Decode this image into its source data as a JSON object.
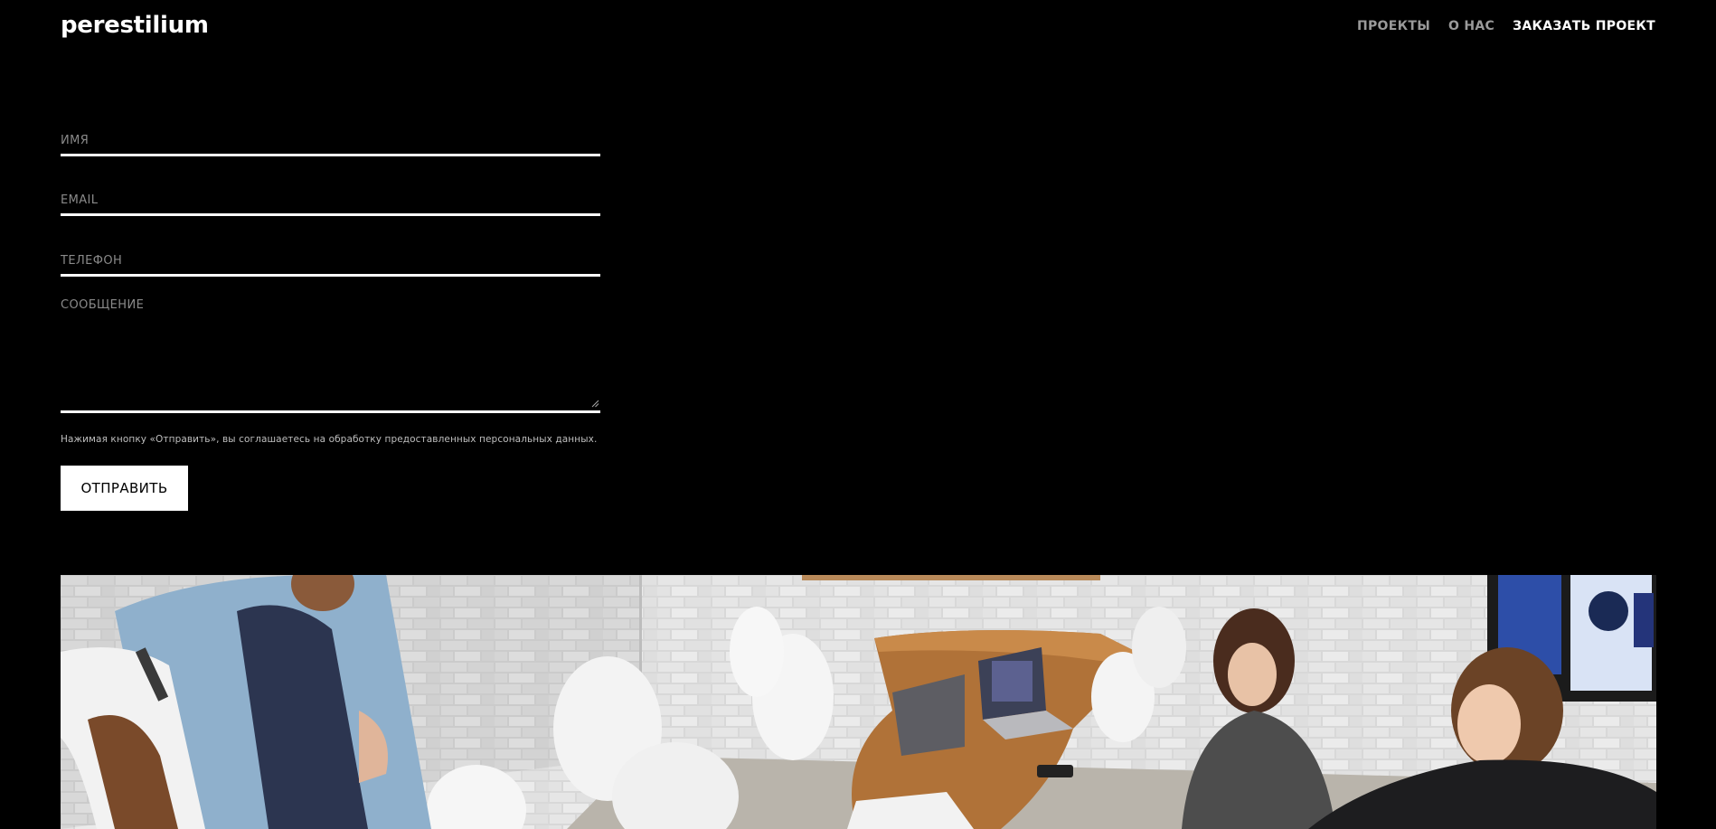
{
  "header": {
    "logo": "perestilium",
    "nav": [
      {
        "label": "ПРОЕКТЫ",
        "active": false
      },
      {
        "label": "О НАС",
        "active": false
      },
      {
        "label": "ЗАКАЗАТЬ ПРОЕКТ",
        "active": true
      }
    ]
  },
  "form": {
    "name_placeholder": "ИМЯ",
    "name_value": "",
    "email_placeholder": "EMAIL",
    "email_value": "",
    "phone_placeholder": "ТЕЛЕФОН",
    "phone_value": "",
    "message_placeholder": "СООБЩЕНИЕ",
    "message_value": "",
    "consent_text": "Нажимая кнопку «Отправить», вы соглашаетесь на обработку предоставленных персональных данных.",
    "submit_label": "ОТПРАВИТЬ"
  },
  "colors": {
    "background": "#000000",
    "text": "#ffffff",
    "muted": "#9a9a9a",
    "button_bg": "#ffffff",
    "button_text": "#000000"
  }
}
